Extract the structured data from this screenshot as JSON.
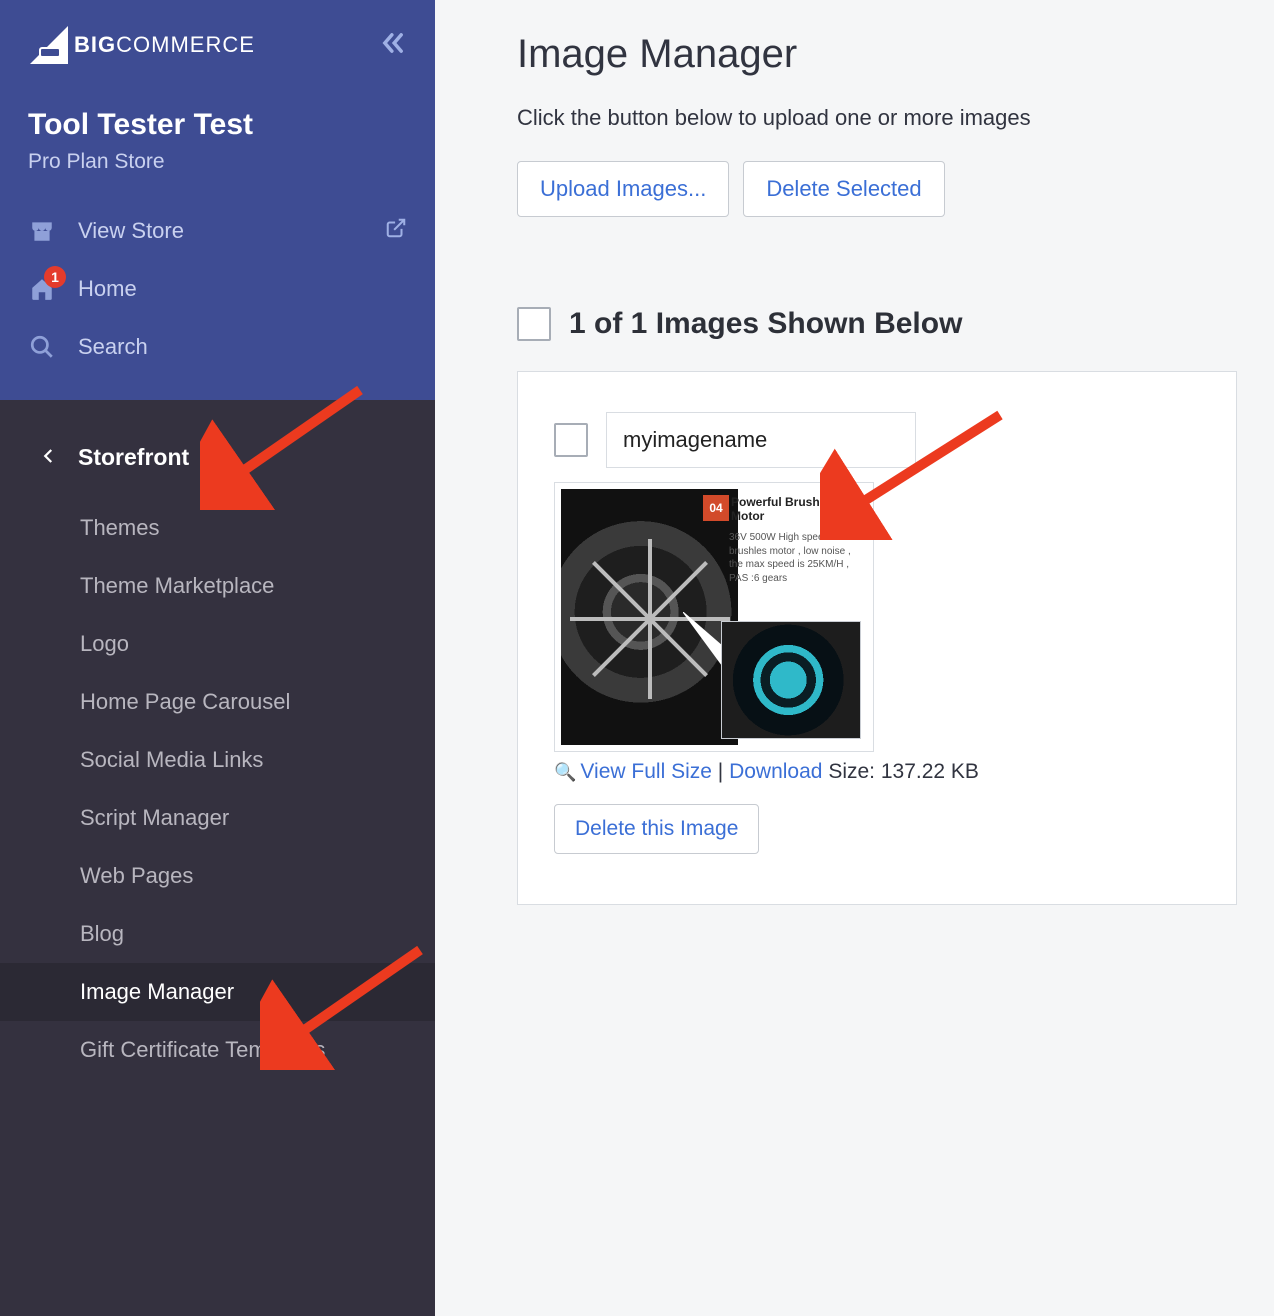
{
  "brand": {
    "bold": "BIG",
    "rest": "COMMERCE"
  },
  "store": {
    "name": "Tool Tester Test",
    "plan": "Pro Plan Store"
  },
  "topnav": {
    "view_store": "View Store",
    "home": "Home",
    "home_badge": "1",
    "search": "Search"
  },
  "section": {
    "title": "Storefront"
  },
  "subnav": [
    "Themes",
    "Theme Marketplace",
    "Logo",
    "Home Page Carousel",
    "Social Media Links",
    "Script Manager",
    "Web Pages",
    "Blog",
    "Image Manager",
    "Gift Certificate Templates"
  ],
  "subnav_active_index": 8,
  "main": {
    "title": "Image Manager",
    "desc": "Click the button below to upload one or more images",
    "upload_btn": "Upload Images...",
    "delete_selected_btn": "Delete Selected",
    "images_heading": "1 of 1 Images Shown Below"
  },
  "card": {
    "name_value": "myimagename",
    "callout_num": "04",
    "callout_title": "Powerful Brushless Motor",
    "callout_body": "36V 500W High speed brushles motor , low noise , the max speed is 25KM/H , PAS :6 gears",
    "view_full": "View Full Size",
    "download": "Download",
    "size_label": "Size:",
    "size_value": "137.22 KB",
    "delete_btn": "Delete this Image"
  }
}
